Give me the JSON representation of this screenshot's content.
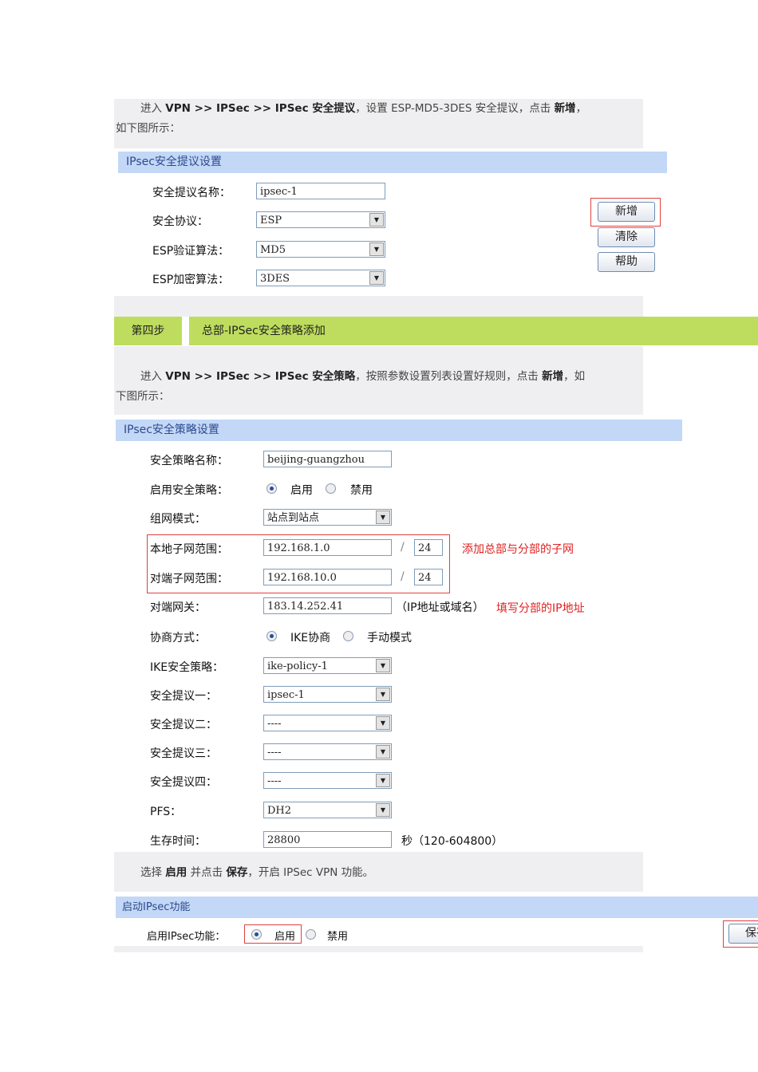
{
  "intro1": {
    "pre": "进入 ",
    "path": "VPN >> IPSec >> IPSec 安全提议",
    "mid": "，设置 ESP-MD5-3DES 安全提议，点击 ",
    "btn": "新增",
    "post": "，",
    "line2": "如下图所示："
  },
  "proposal": {
    "title": "IPsec安全提议设置",
    "rows": [
      {
        "label": "安全提议名称：",
        "value": "ipsec-1"
      },
      {
        "label": "安全协议：",
        "value": "ESP"
      },
      {
        "label": "ESP验证算法：",
        "value": "MD5"
      },
      {
        "label": "ESP加密算法：",
        "value": "3DES"
      }
    ],
    "buttons": {
      "add": "新增",
      "clear": "清除",
      "help": "帮助"
    }
  },
  "step": {
    "number": "第四步",
    "title": "总部-IPSec安全策略添加"
  },
  "intro2": {
    "pre": "进入 ",
    "path": "VPN >> IPSec >> IPSec 安全策略",
    "mid": "，按照参数设置列表设置好规则，点击 ",
    "btn": "新增",
    "post": "，如",
    "line2": "下图所示："
  },
  "policy": {
    "title": "IPsec安全策略设置",
    "name_label": "安全策略名称：",
    "name_value": "beijing-guangzhou",
    "enable_label": "启用安全策略：",
    "enable_on": "启用",
    "enable_off": "禁用",
    "mode_label": "组网模式：",
    "mode_value": "站点到站点",
    "local_label": "本地子网范围：",
    "local_ip": "192.168.1.0",
    "local_mask": "24",
    "remote_label": "对端子网范围：",
    "remote_ip": "192.168.10.0",
    "remote_mask": "24",
    "slash": "/",
    "note1": "添加总部与分部的子网",
    "gw_label": "对端网关：",
    "gw_value": "183.14.252.41",
    "gw_hint": "（IP地址或域名）",
    "note2": "填写分部的IP地址",
    "nego_label": "协商方式：",
    "nego_ike": "IKE协商",
    "nego_manual": "手动模式",
    "ike_label": "IKE安全策略：",
    "ike_value": "ike-policy-1",
    "p1_label": "安全提议一：",
    "p1_value": "ipsec-1",
    "p2_label": "安全提议二：",
    "p2_value": "----",
    "p3_label": "安全提议三：",
    "p3_value": "----",
    "p4_label": "安全提议四：",
    "p4_value": "----",
    "pfs_label": "PFS：",
    "pfs_value": "DH2",
    "life_label": "生存时间：",
    "life_value": "28800",
    "life_hint": "秒（120-604800）"
  },
  "intro3": {
    "a": "选择 ",
    "b": "启用",
    "c": " 并点击 ",
    "d": "保存",
    "e": "，开启 IPSec VPN 功能。"
  },
  "enable": {
    "title": "启动IPsec功能",
    "label": "启用IPsec功能：",
    "on": "启用",
    "off": "禁用",
    "save": "保存"
  }
}
